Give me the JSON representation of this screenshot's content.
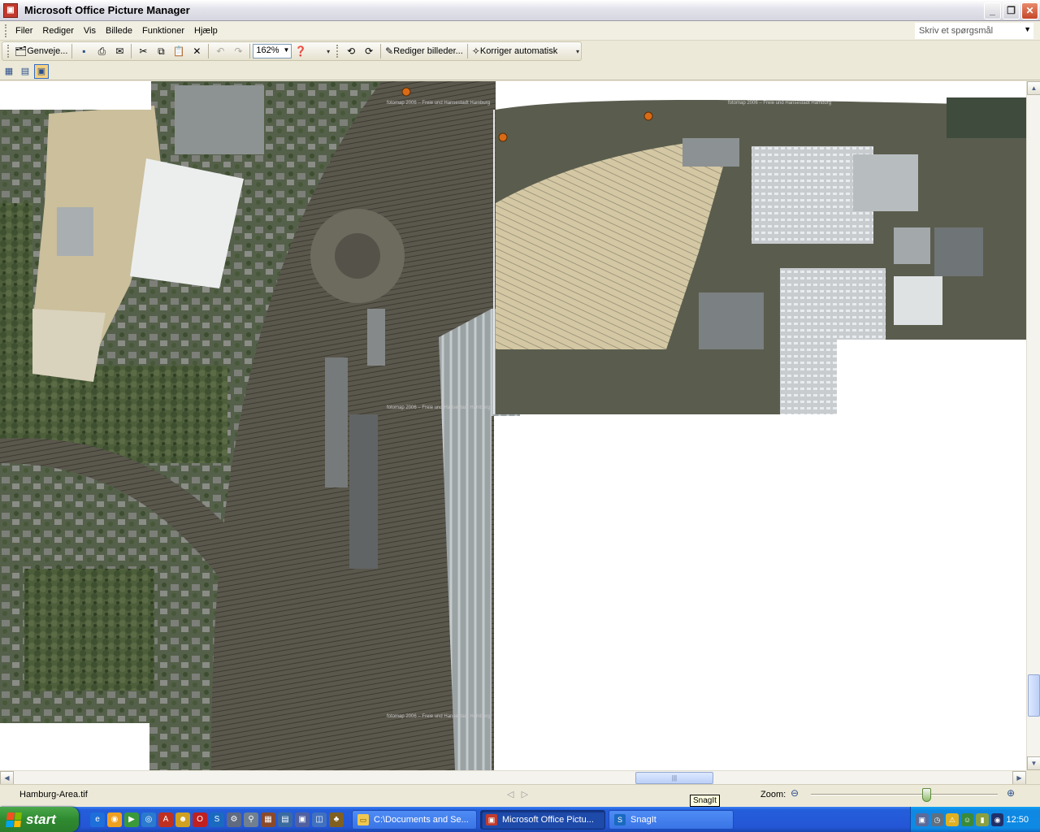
{
  "window": {
    "title": "Microsoft Office Picture Manager"
  },
  "menu": {
    "items": [
      "Filer",
      "Rediger",
      "Vis",
      "Billede",
      "Funktioner",
      "Hjælp"
    ],
    "question_placeholder": "Skriv et spørgsmål"
  },
  "toolbar": {
    "shortcuts_label": "Genveje...",
    "zoom_value": "162%",
    "edit_pictures_label": "Rediger billeder...",
    "auto_correct_label": "Korriger automatisk"
  },
  "image": {
    "filename": "Hamburg-Area.tif",
    "watermark": "fotomap 2006 – Freie und Hansestadt Hamburg"
  },
  "status": {
    "zoom_label": "Zoom:",
    "zoom_level": 0.62,
    "tooltip": "SnagIt"
  },
  "taskbar": {
    "start_label": "start",
    "tasks": [
      {
        "label": "C:\\Documents and Se...",
        "icon": "folder-icon",
        "active": false
      },
      {
        "label": "Microsoft Office Pictu...",
        "icon": "picture-manager-icon",
        "active": true
      },
      {
        "label": "SnagIt",
        "icon": "snagit-icon",
        "active": false
      }
    ],
    "clock": "12:50"
  },
  "colors": {
    "taskbar_blue": "#245edb",
    "start_green": "#2f8a30",
    "tray_blue": "#0f8ae4"
  }
}
